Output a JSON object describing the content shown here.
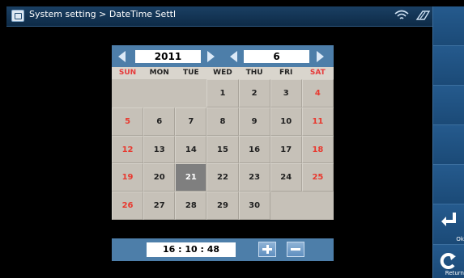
{
  "titlebar": {
    "title": "System setting > DateTime Settl",
    "icons": [
      "settings-window-icon",
      "wifi-icon",
      "signal-icon"
    ]
  },
  "calendar": {
    "year": "2011",
    "month": "6",
    "weekdays": [
      "SUN",
      "MON",
      "TUE",
      "WED",
      "THU",
      "FRI",
      "SAT"
    ],
    "weeks": [
      [
        "",
        "",
        "",
        "1",
        "2",
        "3",
        "4"
      ],
      [
        "5",
        "6",
        "7",
        "8",
        "9",
        "10",
        "11"
      ],
      [
        "12",
        "13",
        "14",
        "15",
        "16",
        "17",
        "18"
      ],
      [
        "19",
        "20",
        "21",
        "22",
        "23",
        "24",
        "25"
      ],
      [
        "26",
        "27",
        "28",
        "29",
        "30",
        "",
        ""
      ]
    ],
    "selected_day": "21"
  },
  "time": {
    "value": "16 : 10 : 48",
    "buttons": [
      "plus-icon",
      "minus-icon"
    ]
  },
  "sidebar": {
    "ok_label": "Ok",
    "return_label": "Return",
    "icons": [
      "enter-icon",
      "return-icon"
    ]
  },
  "colors": {
    "accent": "#4d7ea9",
    "weekend": "#e8392f",
    "selected": "#7f7f7f"
  }
}
